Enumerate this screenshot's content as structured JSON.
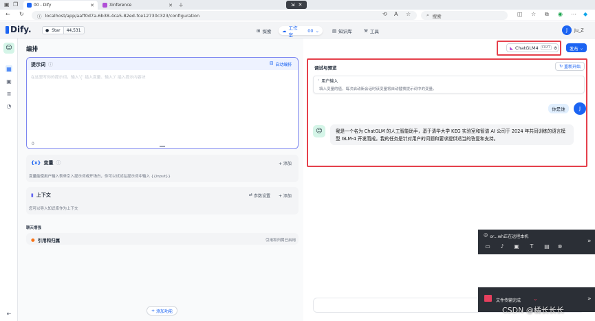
{
  "browser": {
    "tabs": [
      {
        "label": "00 - Dify"
      },
      {
        "label": "Xinference"
      }
    ],
    "url": "localhost/app/aaff0d7a-6b38-4ca5-82ed-fce12730c323/configuration",
    "search_placeholder": "搜索"
  },
  "header": {
    "logo": "Dify.",
    "star_label": "Star",
    "star_count": "44,531",
    "nav": [
      {
        "label": "探索",
        "icon": "explore-icon"
      },
      {
        "label": "工作室",
        "icon": "studio-icon"
      },
      {
        "label": "00",
        "icon": "chevron-down-icon"
      },
      {
        "label": "知识库",
        "icon": "knowledge-icon"
      },
      {
        "label": "工具",
        "icon": "tools-icon"
      }
    ],
    "user_initial": "J",
    "user_name": "Ju_Z"
  },
  "left": {
    "page_title": "编排",
    "prompt": {
      "title": "提示词",
      "auto_label": "自动编排",
      "placeholder": "在这里写你的提示词，输入'{' 插入变量、输入'/' 插入提示内容块",
      "count": "0"
    },
    "variables": {
      "title": "变量",
      "add_label": "+ 添加",
      "desc": "变量能使用户输入表单引入提示词或开场白，你可以试试在提示词中输入 {{input}}"
    },
    "context": {
      "title": "上下文",
      "settings_label": "参数设置",
      "add_label": "+ 添加",
      "desc": "您可以导入知识库作为上下文"
    },
    "enhance": {
      "title": "聊天增强",
      "item_label": "引用和归属",
      "item_status": "引用和归属已启用"
    },
    "add_feature_label": "添加功能"
  },
  "right": {
    "model_name": "ChatGLM4",
    "model_tag": "CHAT",
    "publish_label": "发布",
    "panel_title": "调试与预览",
    "restart_label": "重新开始",
    "user_inputs_title": "用户输入",
    "user_inputs_desc": "填入变量的值，每次启动新会话时该变量将自动替换提示词中的变量。",
    "user_message": "你是谁",
    "user_initial": "J",
    "bot_message": "我是一个名为 ChatGLM 的人工智能助手，基于清华大学 KEG 实验室和智谱 AI 公司于 2024 年共同训练的语言模型 GLM-4 开发而成。我的任务是针对用户的问题和要求提供适当的答复和支持。"
  },
  "overlays": {
    "remote_title": "or...wh正在远程本机",
    "file_transfer": "文件传输完成",
    "watermark": "CSDN @橘长长长"
  },
  "colors": {
    "accent": "#1c64f2",
    "highlight": "#e5404b"
  }
}
